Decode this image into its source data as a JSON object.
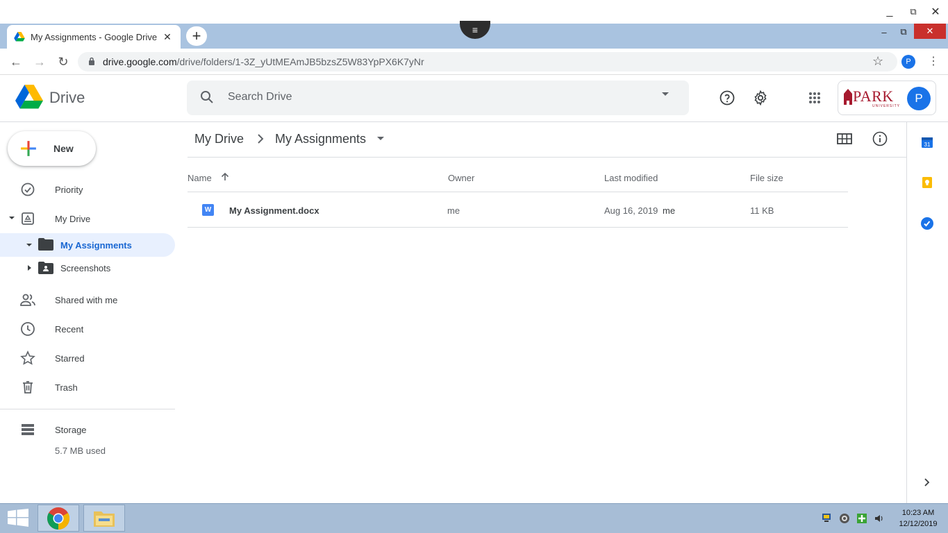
{
  "window_controls": {
    "minimize": "_",
    "maximize": "⧉",
    "close": "✕"
  },
  "browser": {
    "tab_title": "My Assignments - Google Drive",
    "tab_close": "✕",
    "new_tab": "+",
    "chrome_min": "–",
    "chrome_restore": "⧉",
    "chrome_close": "✕",
    "url_host": "drive.google.com",
    "url_path": "/drive/folders/1-3Z_yUtMEAmJB5bzsZ5W83YpPX6K7yNr",
    "profile_initial": "P"
  },
  "header": {
    "app_name": "Drive",
    "search_placeholder": "Search Drive",
    "org_logo_text": "PARK",
    "org_logo_sub": "UNIVERSITY",
    "avatar_initial": "P"
  },
  "sidebar": {
    "new_label": "New",
    "items": [
      {
        "label": "Priority"
      },
      {
        "label": "My Drive"
      },
      {
        "label": "My Assignments"
      },
      {
        "label": "Screenshots"
      },
      {
        "label": "Shared with me"
      },
      {
        "label": "Recent"
      },
      {
        "label": "Starred"
      },
      {
        "label": "Trash"
      }
    ],
    "storage_label": "Storage",
    "storage_used": "5.7 MB used"
  },
  "breadcrumb": {
    "root": "My Drive",
    "current": "My Assignments"
  },
  "table": {
    "columns": [
      "Name",
      "Owner",
      "Last modified",
      "File size"
    ],
    "rows": [
      {
        "name": "My Assignment.docx",
        "owner": "me",
        "modified_date": "Aug 16, 2019",
        "modified_by": "me",
        "size": "11 KB",
        "icon_letter": "W"
      }
    ]
  },
  "rail": {
    "calendar_day": "31"
  },
  "taskbar": {
    "time": "10:23 AM",
    "date": "12/12/2019"
  },
  "colors": {
    "accent": "#1a73e8",
    "active_bg": "#e8f0fe",
    "tabstrip": "#a9c3e0",
    "taskbar": "#a7bdd6"
  }
}
